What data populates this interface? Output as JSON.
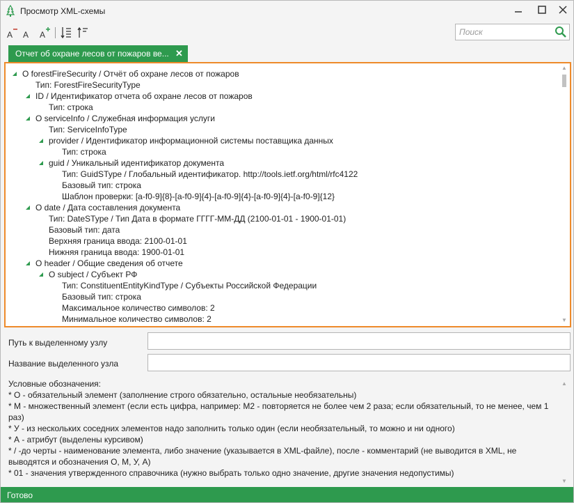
{
  "window": {
    "title": "Просмотр XML-схемы",
    "minimize_icon": "minimize-icon",
    "maximize_icon": "maximize-icon",
    "close_icon": "close-icon"
  },
  "toolbar": {
    "icons": [
      "font-decrease-icon",
      "font-reset-icon",
      "font-increase-icon",
      "expand-all-icon",
      "collapse-all-icon"
    ]
  },
  "search": {
    "placeholder": "Поиск",
    "value": ""
  },
  "tab": {
    "label": "Отчет об охране лесов от пожаров ве..."
  },
  "tree": {
    "rows": [
      {
        "text": "О forestFireSecurity / Отчёт об охране лесов от пожаров",
        "level": 0,
        "arrow": true
      },
      {
        "text": "Тип: ForestFireSecurityType",
        "level": 1,
        "arrow": false
      },
      {
        "text": "ID / Идентификатор отчета об охране лесов от пожаров",
        "level": 1,
        "arrow": true
      },
      {
        "text": "Тип: строка",
        "level": 2,
        "arrow": false
      },
      {
        "text": "О serviceInfo / Служебная информация услуги",
        "level": 1,
        "arrow": true
      },
      {
        "text": "Тип: ServiceInfoType",
        "level": 2,
        "arrow": false
      },
      {
        "text": "provider / Идентификатор информационной системы поставщика данных",
        "level": 2,
        "arrow": true
      },
      {
        "text": "Тип: строка",
        "level": 3,
        "arrow": false
      },
      {
        "text": "guid / Уникальный идентификатор документа",
        "level": 2,
        "arrow": true
      },
      {
        "text": "Тип: GuidSType / Глобальный идентификатор. http://tools.ietf.org/html/rfc4122",
        "level": 3,
        "arrow": false
      },
      {
        "text": "Базовый тип: строка",
        "level": 3,
        "arrow": false
      },
      {
        "text": "Шаблон проверки: [a-f0-9]{8}-[a-f0-9]{4}-[a-f0-9]{4}-[a-f0-9]{4}-[a-f0-9]{12}",
        "level": 3,
        "arrow": false
      },
      {
        "text": "О date / Дата составления документа",
        "level": 1,
        "arrow": true
      },
      {
        "text": "Тип: DateSType / Тип Дата в формате ГГГГ-ММ-ДД (2100-01-01 - 1900-01-01)",
        "level": 2,
        "arrow": false
      },
      {
        "text": "Базовый тип: дата",
        "level": 2,
        "arrow": false
      },
      {
        "text": "Верхняя граница ввода: 2100-01-01",
        "level": 2,
        "arrow": false
      },
      {
        "text": "Нижняя граница ввода: 1900-01-01",
        "level": 2,
        "arrow": false
      },
      {
        "text": "О header / Общие сведения об отчете",
        "level": 1,
        "arrow": true
      },
      {
        "text": "О subject / Субъект РФ",
        "level": 2,
        "arrow": true
      },
      {
        "text": "Тип: ConstituentEntityKindType / Субъекты Российской Федерации",
        "level": 3,
        "arrow": false
      },
      {
        "text": "Базовый тип: строка",
        "level": 3,
        "arrow": false
      },
      {
        "text": "Максимальное количество символов: 2",
        "level": 3,
        "arrow": false
      },
      {
        "text": "Минимальное количество символов: 2",
        "level": 3,
        "arrow": false
      }
    ]
  },
  "fields": {
    "path_label": "Путь к выделенному узлу",
    "path_value": "",
    "name_label": "Название выделенного узла",
    "name_value": ""
  },
  "legend": {
    "lines": [
      "Условные обозначения:",
      "* О - обязательный элемент (заполнение строго обязательно, остальные необязательны)",
      "* М - множественный элемент (если есть цифра, например: М2 - повторяется не более чем 2 раза; если обязательный, то не менее, чем 1 раз)",
      "* У - из нескольких соседних элементов надо заполнить только один (если необязательный, то можно и ни одного)",
      "* А - атрибут (выделены курсивом)",
      "* / -до черты - наименование элемента, либо значение (указывается в XML-файле), после - комментарий (не выводится в XML, не выводятся и обозначения О, М, У, А)",
      "* 01 - значения утвержденного справочника (нужно выбрать только одно значение, другие значения недопустимы)"
    ]
  },
  "status": {
    "text": "Готово"
  },
  "colors": {
    "accent": "#2e9a4e",
    "highlight_border": "#ee8a2a"
  }
}
